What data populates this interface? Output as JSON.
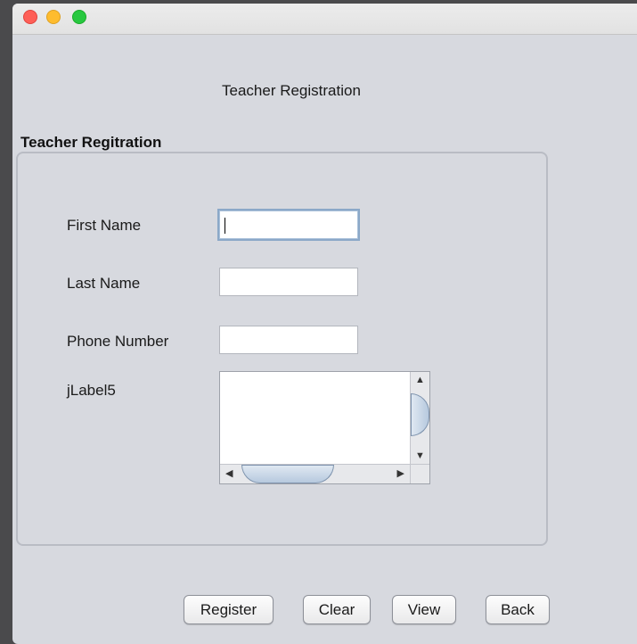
{
  "window": {
    "traffic_lights": {
      "close": "#fe5f57",
      "minimize": "#febc2e",
      "maximize": "#28c840"
    }
  },
  "heading": "Teacher Registration",
  "group_title": "Teacher Regitration",
  "form": {
    "first_name": {
      "label": "First Name",
      "value": ""
    },
    "last_name": {
      "label": "Last Name",
      "value": ""
    },
    "phone_number": {
      "label": "Phone Number",
      "value": ""
    },
    "extra": {
      "label": "jLabel5",
      "value": ""
    }
  },
  "scroll_icons": {
    "up": "▲",
    "down": "▼",
    "left": "◀",
    "right": "▶"
  },
  "buttons": {
    "register": "Register",
    "clear": "Clear",
    "view": "View",
    "back": "Back"
  }
}
